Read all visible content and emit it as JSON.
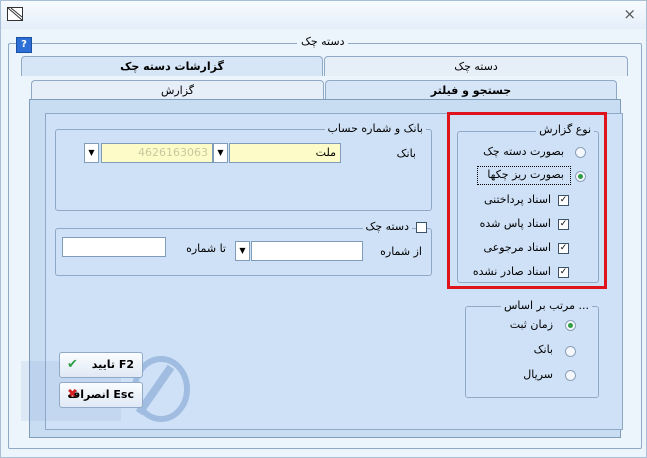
{
  "window": {
    "title": "دسته چک",
    "close_glyph": "×",
    "help_glyph": "?"
  },
  "tabs_top": [
    {
      "label": "دسته چک",
      "active": false
    },
    {
      "label": "گزارشات دسته چک",
      "active": true
    }
  ],
  "tabs_sub": [
    {
      "label": "جستجو و فیلتر",
      "active": true
    },
    {
      "label": "گزارش",
      "active": false
    }
  ],
  "bank_group": {
    "legend": "بانک و شماره حساب",
    "bank_label": "بانک",
    "bank_value": "ملت",
    "account_value": "4626163063"
  },
  "checkbook_group": {
    "legend": "دسته چک",
    "from_label": "از شماره",
    "to_label": "تا شماره",
    "from_value": "",
    "to_value": ""
  },
  "report_type": {
    "legend": "نوع گزارش",
    "options": [
      {
        "label": "بصورت دسته چک",
        "selected": false
      },
      {
        "label": "بصورت ریز چکها",
        "selected": true
      }
    ],
    "checks": [
      {
        "label": "اسناد پرداختنی",
        "checked": true
      },
      {
        "label": "اسناد پاس شده",
        "checked": true
      },
      {
        "label": "اسناد مرجوعی",
        "checked": true
      },
      {
        "label": "اسناد صادر نشده",
        "checked": true
      }
    ]
  },
  "sort_by": {
    "legend": "مرتب بر اساس ...",
    "options": [
      {
        "label": "زمان ثبت",
        "selected": true
      },
      {
        "label": "بانک",
        "selected": false
      },
      {
        "label": "سریال",
        "selected": false
      }
    ]
  },
  "buttons": {
    "ok_label": "تایید F2",
    "cancel_label": "انصراف Esc"
  },
  "colors": {
    "highlight": "#e0141c",
    "check_ok": "#2f9e45",
    "cancel_x": "#d42020"
  }
}
